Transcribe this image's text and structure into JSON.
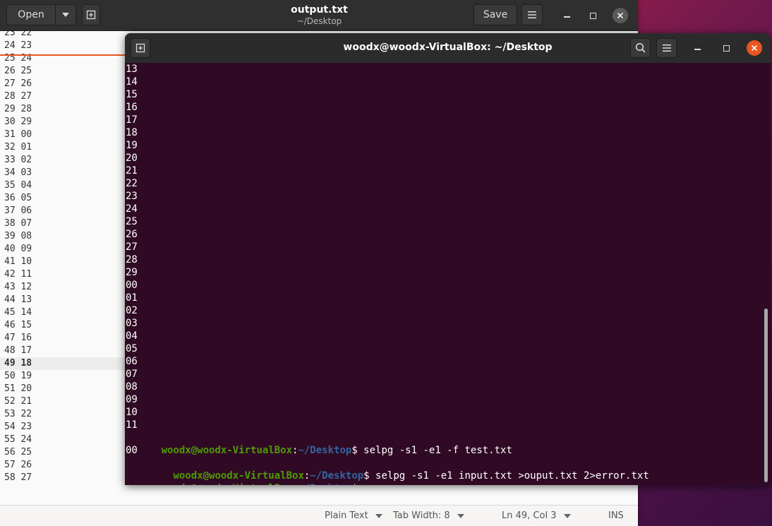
{
  "gedit": {
    "open_label": "Open",
    "title": "output.txt",
    "subtitle": "~/Desktop",
    "save_label": "Save",
    "lines": [
      "23 22",
      "24 23",
      "25 24",
      "26 25",
      "27 26",
      "28 27",
      "29 28",
      "30 29",
      "31 00",
      "32 01",
      "33 02",
      "34 03",
      "35 04",
      "36 05",
      "37 06",
      "38 07",
      "39 08",
      "40 09",
      "41 10",
      "42 11",
      "43 12",
      "44 13",
      "45 14",
      "46 15",
      "47 16",
      "48 17",
      "49 18",
      "50 19",
      "51 20",
      "52 21",
      "53 22",
      "54 23",
      "55 24",
      "56 25",
      "57 26",
      "58 27"
    ],
    "status": {
      "language": "Plain Text",
      "tab_width": "Tab Width: 8",
      "position": "Ln 49, Col 3",
      "mode": "INS"
    }
  },
  "terminal": {
    "title": "woodx@woodx-VirtualBox: ~/Desktop",
    "output_lines": [
      "13",
      "14",
      "15",
      "16",
      "17",
      "18",
      "19",
      "20",
      "21",
      "22",
      "23",
      "24",
      "25",
      "26",
      "27",
      "28",
      "29",
      "00",
      "01",
      "02",
      "03",
      "04",
      "05",
      "06",
      "07",
      "08",
      "09",
      "10",
      "11"
    ],
    "prompt": {
      "user": "woodx@woodx-VirtualBox",
      "sep": ":",
      "path": "~/Desktop",
      "dollar": "$"
    },
    "cmd1": " selpg -s1 -e1 -f test.txt",
    "out1": "00",
    "line2_indent": "  ",
    "cmd2": " selpg -s1 -e1 input.txt >ouput.txt 2>error.txt",
    "cmd3": ""
  },
  "icons": {
    "new_tab": "new-tab-icon",
    "dropdown": "chevron-down-icon",
    "menu": "hamburger-menu-icon",
    "search": "search-icon",
    "minimize": "minimize-icon",
    "maximize": "maximize-icon",
    "close": "close-icon"
  },
  "colors": {
    "terminal_bg": "#300a24",
    "prompt_user": "#4e9a06",
    "prompt_path": "#3465a4",
    "close_accent": "#e95420"
  }
}
